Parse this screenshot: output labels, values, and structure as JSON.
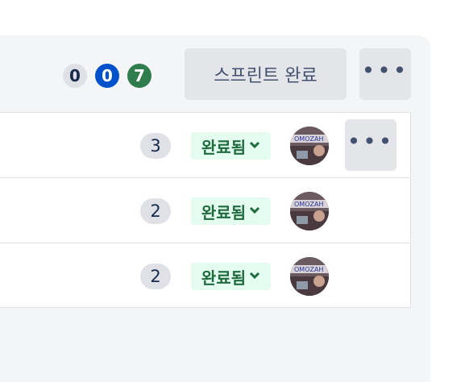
{
  "sprint_header": {
    "counts": {
      "todo": "0",
      "in_progress": "0",
      "done": "7"
    },
    "complete_button_label": "스프린트 완료",
    "more_label": "•••"
  },
  "issues": [
    {
      "points": "3",
      "status": "완료됨",
      "more_label": "•••"
    },
    {
      "points": "2",
      "status": "완료됨"
    },
    {
      "points": "2",
      "status": "완료됨"
    }
  ],
  "colors": {
    "todo_badge": "#dfe1e6",
    "in_progress_badge": "#0052cc",
    "done_badge": "#2f7d4d",
    "status_done_bg": "#e3fcef",
    "status_done_text": "#1f6b3e"
  },
  "icons": {
    "status_dropdown": "chevron-down-icon",
    "more": "more-horizontal-icon",
    "avatar": "user-avatar-photo"
  }
}
